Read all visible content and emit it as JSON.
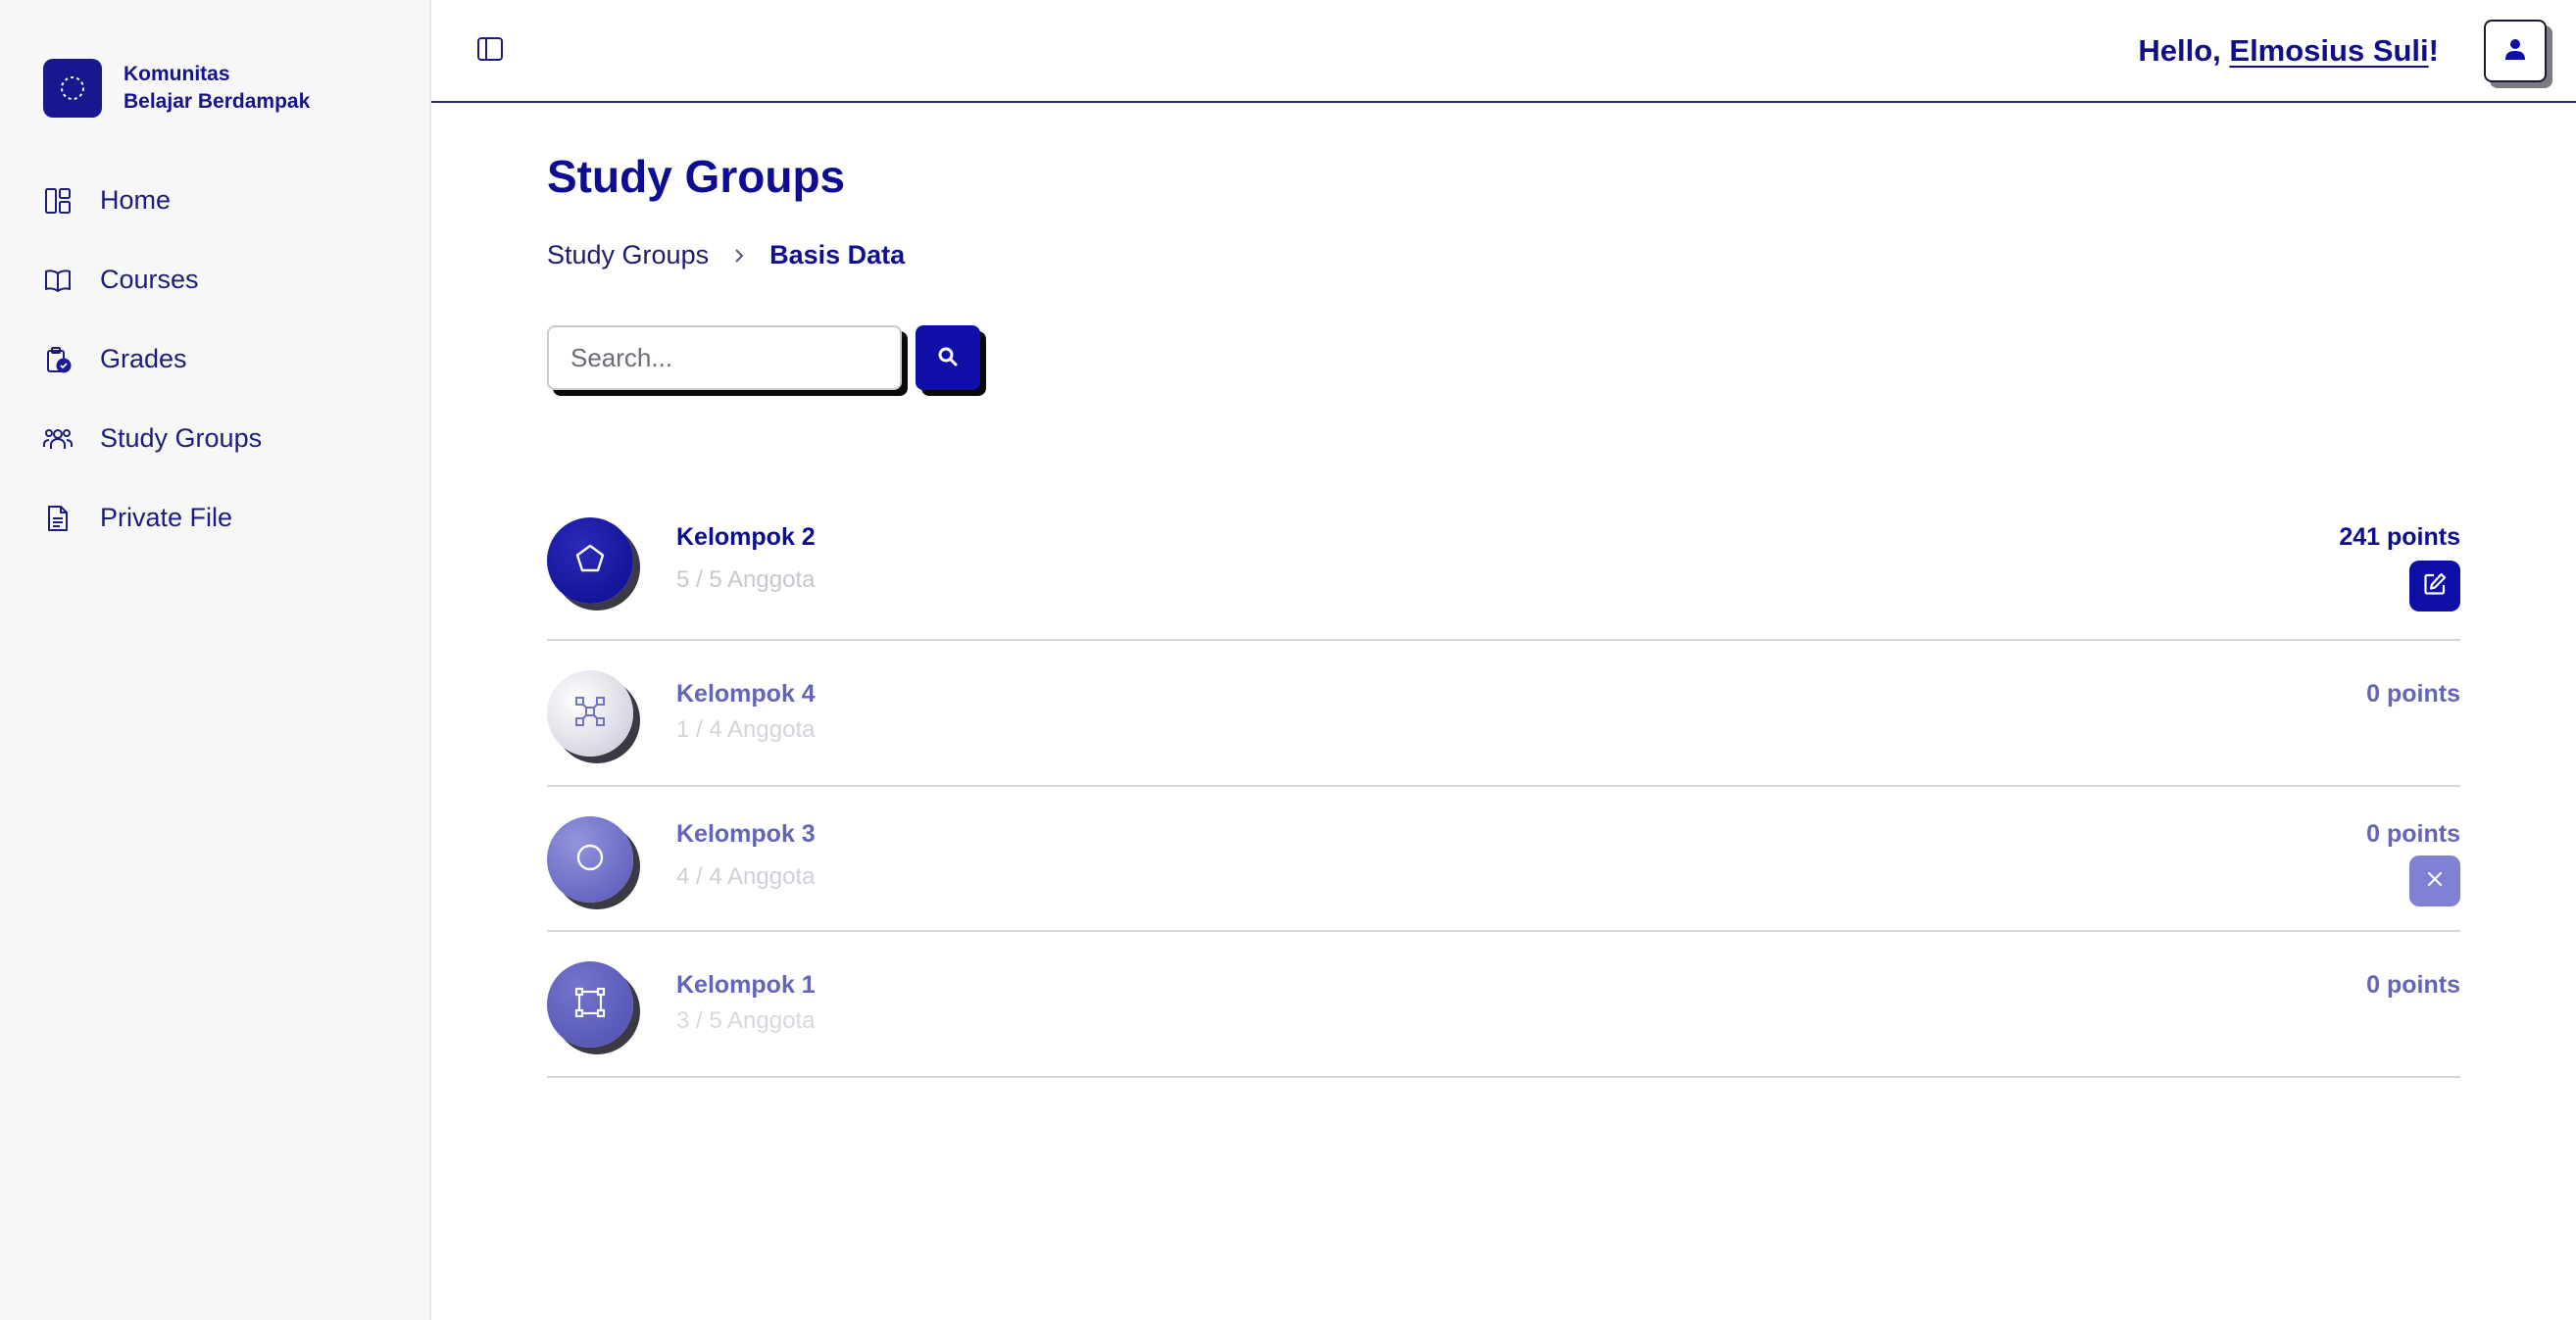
{
  "brand": {
    "line1": "Komunitas",
    "line2": "Belajar Berdampak"
  },
  "sidebar": {
    "items": [
      {
        "label": "Home",
        "icon": "dashboard-icon"
      },
      {
        "label": "Courses",
        "icon": "book-icon"
      },
      {
        "label": "Grades",
        "icon": "clipboard-check-icon"
      },
      {
        "label": "Study Groups",
        "icon": "users-icon"
      },
      {
        "label": "Private File",
        "icon": "file-icon"
      }
    ]
  },
  "header": {
    "greeting_prefix": "Hello, ",
    "username": "Elmosius Suli",
    "greeting_suffix": "!"
  },
  "page": {
    "title": "Study Groups"
  },
  "breadcrumb": {
    "parent": "Study Groups",
    "current": "Basis Data"
  },
  "search": {
    "placeholder": "Search...",
    "value": ""
  },
  "groups": [
    {
      "name": "Kelompok 2",
      "members": "5 / 5 Anggota",
      "points": "241 points",
      "icon": "pentagon-icon",
      "action": "edit-icon"
    },
    {
      "name": "Kelompok 4",
      "members": "1 / 4 Anggota",
      "points": "0 points",
      "icon": "network-icon",
      "action": null
    },
    {
      "name": "Kelompok 3",
      "members": "4 / 4 Anggota",
      "points": "0 points",
      "icon": "circle-icon",
      "action": "close-icon"
    },
    {
      "name": "Kelompok 1",
      "members": "3 / 5 Anggota",
      "points": "0 points",
      "icon": "frame-icon",
      "action": null
    }
  ],
  "colors": {
    "primary": "#0f0fa8",
    "muted": "#6464b8",
    "sidebar_bg": "#f7f7f8",
    "divider": "#d6d6dc"
  }
}
